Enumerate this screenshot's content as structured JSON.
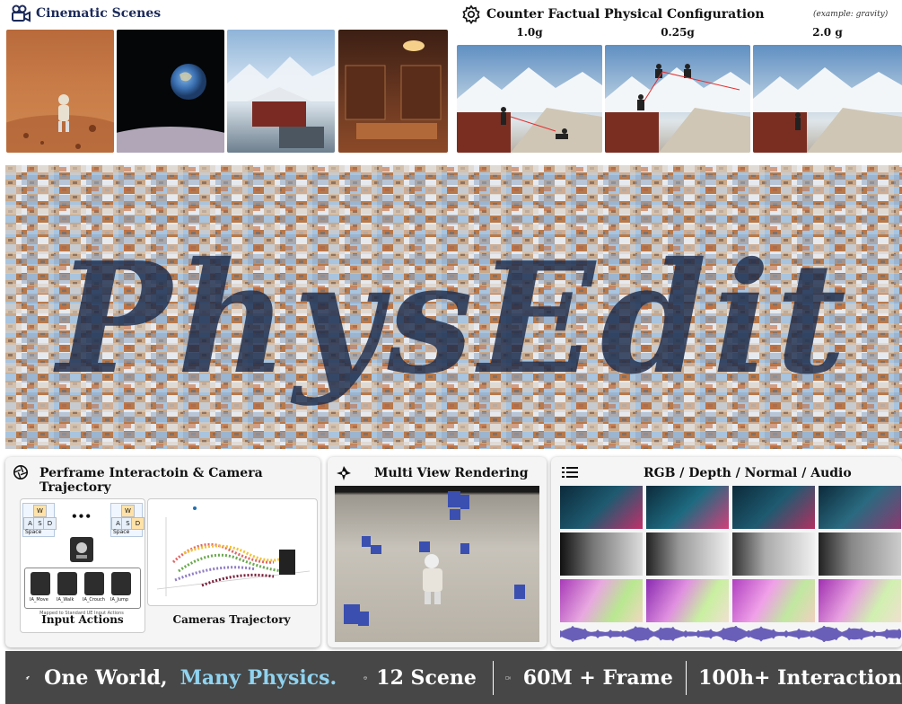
{
  "cinematic": {
    "title": "Cinematic Scenes"
  },
  "counterfactual": {
    "title": "Counter Factual Physical Configuration",
    "example": "(example: gravity)",
    "labels": [
      "1.0g",
      "0.25g",
      "2.0 g"
    ]
  },
  "mosaic": {
    "text": "PhysEdit"
  },
  "interaction": {
    "title": "Perframe Interactoin & Camera Trajectory",
    "keys": [
      "W",
      "A",
      "S",
      "D"
    ],
    "space_label": "Space",
    "dots": "•••",
    "actions": [
      "IA_Move",
      "IA_Walk",
      "IA_Crouch",
      "IA_Jump"
    ],
    "mapped_caption": "Mapped to Standard UE Input Actions",
    "input_caption": "Input Actions",
    "camera_caption": "Cameras Trajectory"
  },
  "multiview": {
    "title": "Multi View Rendering"
  },
  "modalities": {
    "title": "RGB / Depth / Normal / Audio"
  },
  "bottom_bar": {
    "slogan_prefix": "One World,",
    "slogan_highlight": "Many Physics.",
    "scene": "12 Scene",
    "frames": "60M + Frame",
    "interaction": "100h+ Interaction",
    "highlight_color": "#8fd3f0",
    "bg_color": "#474747"
  }
}
